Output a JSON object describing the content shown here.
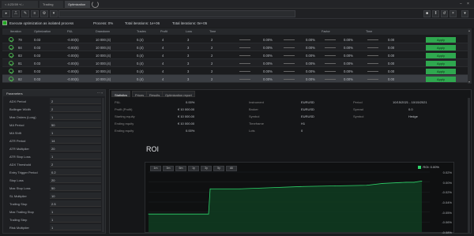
{
  "tabs": [
    {
      "label": "< 4:23:59 +/-:",
      "active": false
    },
    {
      "label": "Trading",
      "active": false
    },
    {
      "label": "Optimization",
      "active": true
    }
  ],
  "filter_row": {
    "checkbox_label": "Execute optimization as isolated process",
    "item1": "Process: 0%",
    "item2": "Total iterations: 1e+06",
    "item3": "Total iterations: 0e+05"
  },
  "results": {
    "headers": [
      "",
      "Iteration",
      "Optimization",
      "P&L",
      "Drawdown",
      "Trades",
      "Profit",
      "Loss",
      "Time",
      "",
      "Factor",
      "",
      "Time",
      "",
      "",
      ""
    ],
    "rows": [
      {
        "id": "79",
        "c2": "0.03",
        "c3": "-0.00(5)",
        "c4": "10 000.(4)",
        "c5": "0.(4)",
        "c6": "4",
        "c7": "3",
        "c8": "2",
        "c9": "0.00%",
        "c10": "0.00%",
        "c11": "0.00%",
        "c12": "0.00",
        "apply": "Apply"
      },
      {
        "id": "84",
        "c2": "0.03",
        "c3": "-0.00(5)",
        "c4": "10 000.(4)",
        "c5": "0.(4)",
        "c6": "4",
        "c7": "3",
        "c8": "2",
        "c9": "0.00%",
        "c10": "0.00%",
        "c11": "0.00%",
        "c12": "0.00",
        "apply": "Apply"
      },
      {
        "id": "83",
        "c2": "0.03",
        "c3": "-0.00(5)",
        "c4": "10 000.(4)",
        "c5": "0.(4)",
        "c6": "4",
        "c7": "3",
        "c8": "2",
        "c9": "0.00%",
        "c10": "0.00%",
        "c11": "0.00%",
        "c12": "0.00",
        "apply": "Apply"
      },
      {
        "id": "81",
        "c2": "0.03",
        "c3": "-0.00(5)",
        "c4": "10 000.(4)",
        "c5": "0.(4)",
        "c6": "4",
        "c7": "3",
        "c8": "2",
        "c9": "0.00%",
        "c10": "0.00%",
        "c11": "0.00%",
        "c12": "0.00",
        "apply": "Apply"
      },
      {
        "id": "80",
        "c2": "0.03",
        "c3": "-0.00(5)",
        "c4": "10 000.(4)",
        "c5": "0.(4)",
        "c6": "4",
        "c7": "3",
        "c8": "2",
        "c9": "0.00%",
        "c10": "0.00%",
        "c11": "0.00%",
        "c12": "0.00",
        "apply": "Apply"
      },
      {
        "id": "82",
        "c2": "0.03",
        "c3": "-0.00(5)",
        "c4": "10 000.(4)",
        "c5": "0.(4)",
        "c6": "4",
        "c7": "3",
        "c8": "2",
        "c9": "0.00%",
        "c10": "0.00%",
        "c11": "0.00%",
        "c12": "0.00",
        "apply": "Apply"
      }
    ]
  },
  "params": {
    "title": "Parameters",
    "items": [
      {
        "label": "ADX Period",
        "value": "2"
      },
      {
        "label": "Bollinger Width",
        "value": "2"
      },
      {
        "label": "Max Orders (Long)",
        "value": "1"
      },
      {
        "label": "MA Period",
        "value": "50"
      },
      {
        "label": "MA Shift",
        "value": "1"
      },
      {
        "label": "ATR Period",
        "value": "14"
      },
      {
        "label": "ATR Multiplier",
        "value": "20"
      },
      {
        "label": "ATR Stop Loss",
        "value": "1"
      },
      {
        "label": "ADX Threshold",
        "value": "2"
      },
      {
        "label": "Entry Trigger Period",
        "value": "0.2"
      },
      {
        "label": "Stop Loss",
        "value": "20"
      },
      {
        "label": "Max Stop Loss",
        "value": "50"
      },
      {
        "label": "SL Multiplier",
        "value": "10"
      },
      {
        "label": "Trailing Stop",
        "value": "2.5"
      },
      {
        "label": "Max Trailing Stop",
        "value": "1"
      },
      {
        "label": "Trailing Step",
        "value": "1"
      },
      {
        "label": "Risk Multiplier",
        "value": "1"
      }
    ]
  },
  "content_tabs": [
    "Statistics",
    "Prices",
    "Results",
    "Optimization report"
  ],
  "stats": {
    "col1": [
      {
        "k": "P&L",
        "v": ""
      },
      {
        "k": "Profit (Profit)",
        "v": "0.00"
      },
      {
        "k": "Starting equity",
        "v": "0.00"
      },
      {
        "k": "Ending equity",
        "v": "0.00"
      },
      {
        "k": "Ending equity",
        "v": "0.00"
      }
    ],
    "col2": [
      {
        "v": "0.00%"
      },
      {
        "v": "€ 10 000.00"
      },
      {
        "v": "€ 10 000.00"
      },
      {
        "v": "€ 10 000.00"
      },
      {
        "v": "0.00%"
      }
    ],
    "col3": [
      {
        "k": "Instrument",
        "v": "EURUSD"
      },
      {
        "k": "Broker",
        "v": "EURUSD"
      },
      {
        "k": "Symbol",
        "v": "EURUSD"
      },
      {
        "k": "Timeframe",
        "v": "H1"
      },
      {
        "k": "Lots",
        "v": "0"
      }
    ],
    "col4": [
      {
        "k": "Period",
        "v": "10/15/2021 - 10/15/2021"
      },
      {
        "k": "Spread",
        "v": "0.0"
      },
      {
        "k": "Symbol",
        "v": "Hedge"
      },
      {
        "k": "",
        "v": ""
      }
    ]
  },
  "roi": {
    "title": "ROI",
    "range_buttons": [
      "1m",
      "3m",
      "6m",
      "1y",
      "3y",
      "5y",
      "All"
    ],
    "legend": "ROI: 0.00%",
    "accent": "#2fd46b"
  },
  "chart_data": {
    "type": "area",
    "title": "ROI",
    "x": [
      0,
      1,
      2,
      3,
      4,
      5,
      6,
      7,
      8,
      9,
      10,
      11
    ],
    "series": [
      {
        "name": "ROI",
        "values": [
          -0.05,
          -0.05,
          -0.008,
          -0.008,
          -0.006,
          -0.004,
          -0.003,
          -0.002,
          0.001,
          0.003,
          0.003,
          0.005
        ]
      }
    ],
    "yticks": [
      "0.02%",
      "0.00%",
      "-0.02%",
      "-0.04%",
      "-0.05%",
      "-0.06%",
      "-0.08%"
    ],
    "ylim": [
      -0.08,
      0.02
    ]
  }
}
